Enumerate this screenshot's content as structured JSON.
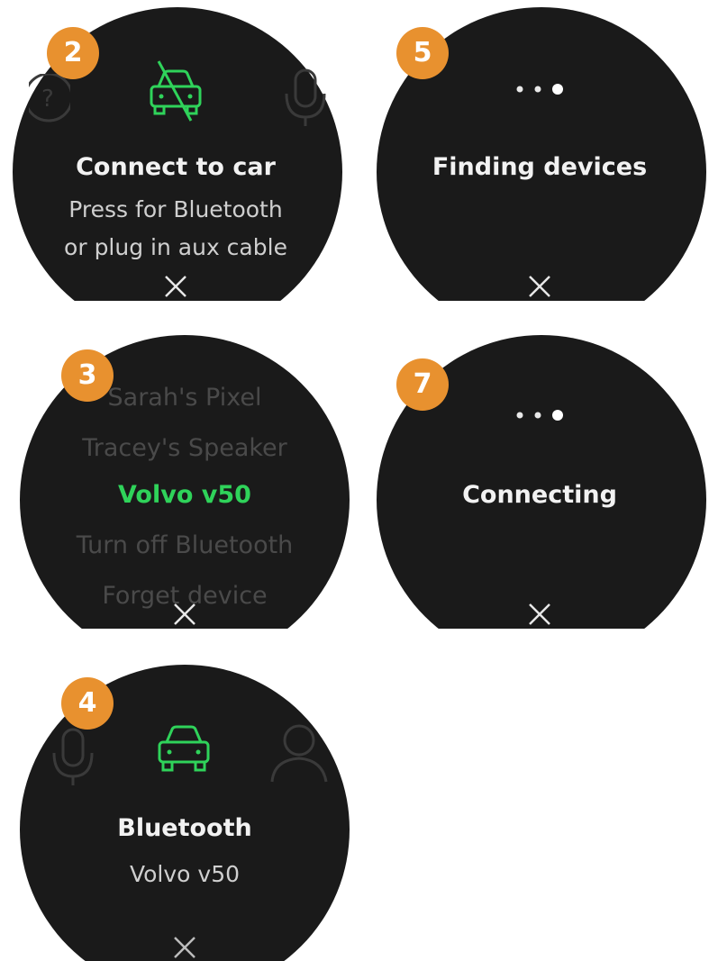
{
  "colors": {
    "screen_bg": "#1a1a1a",
    "badge": "#E8912F",
    "accent_green": "#2fd35a",
    "text_primary": "#f2f2f2",
    "text_secondary": "#cfcfcf",
    "text_dim": "#4a4a4a",
    "page_bg": "#ffffff"
  },
  "screens": [
    {
      "step": "2",
      "icon": "car-disconnected-icon",
      "title": "Connect to car",
      "subtitle_line1": "Press for Bluetooth",
      "subtitle_line2": "or plug in aux cable",
      "close_icon": "close-icon"
    },
    {
      "step": "5",
      "icon": "loading-dots-icon",
      "title": "Finding devices",
      "close_icon": "close-icon"
    },
    {
      "step": "3",
      "list": [
        "Sarah's Pixel",
        "Tracey's Speaker",
        "Volvo v50",
        "Turn off Bluetooth",
        "Forget device"
      ],
      "selected": "Volvo v50",
      "close_icon": "close-icon"
    },
    {
      "step": "7",
      "icon": "loading-dots-icon",
      "title": "Connecting",
      "close_icon": "close-icon"
    },
    {
      "step": "4",
      "icon": "car-icon",
      "title": "Bluetooth",
      "subtitle_line1": "Volvo v50",
      "close_icon": "close-icon"
    }
  ]
}
